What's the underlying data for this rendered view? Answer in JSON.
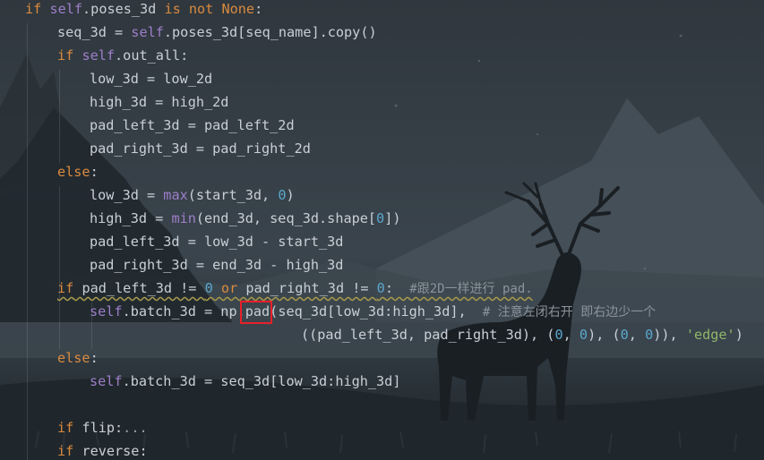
{
  "code": {
    "lines": [
      [
        {
          "t": "if",
          "c": "kw"
        },
        {
          "t": " ",
          "c": ""
        },
        {
          "t": "self",
          "c": "self"
        },
        {
          "t": ".poses_3d ",
          "c": ""
        },
        {
          "t": "is not None",
          "c": "kw"
        },
        {
          "t": ":",
          "c": ""
        }
      ],
      [
        {
          "t": "seq_3d = ",
          "c": ""
        },
        {
          "t": "self",
          "c": "self"
        },
        {
          "t": ".poses_3d[seq_name].copy()",
          "c": ""
        }
      ],
      [
        {
          "t": "if",
          "c": "kw"
        },
        {
          "t": " ",
          "c": ""
        },
        {
          "t": "self",
          "c": "self"
        },
        {
          "t": ".out_all:",
          "c": ""
        }
      ],
      [
        {
          "t": "low_3d = low_2d",
          "c": ""
        }
      ],
      [
        {
          "t": "high_3d = high_2d",
          "c": ""
        }
      ],
      [
        {
          "t": "pad_left_3d = pad_left_2d",
          "c": ""
        }
      ],
      [
        {
          "t": "pad_right_3d = pad_right_2d",
          "c": ""
        }
      ],
      [
        {
          "t": "else",
          "c": "kw"
        },
        {
          "t": ":",
          "c": ""
        }
      ],
      [
        {
          "t": "low_3d = ",
          "c": ""
        },
        {
          "t": "max",
          "c": "self"
        },
        {
          "t": "(start_3d, ",
          "c": ""
        },
        {
          "t": "0",
          "c": "num"
        },
        {
          "t": ")",
          "c": ""
        }
      ],
      [
        {
          "t": "high_3d = ",
          "c": ""
        },
        {
          "t": "min",
          "c": "self"
        },
        {
          "t": "(end_3d, seq_3d.shape[",
          "c": ""
        },
        {
          "t": "0",
          "c": "num"
        },
        {
          "t": "])",
          "c": ""
        }
      ],
      [
        {
          "t": "pad_left_3d = low_3d - start_3d",
          "c": ""
        }
      ],
      [
        {
          "t": "pad_right_3d = end_3d - high_3d",
          "c": ""
        }
      ],
      [
        {
          "t": "if",
          "c": "kw"
        },
        {
          "t": " pad_left_3d != ",
          "c": ""
        },
        {
          "t": "0",
          "c": "num"
        },
        {
          "t": " ",
          "c": ""
        },
        {
          "t": "or",
          "c": "kw"
        },
        {
          "t": " pad_right_3d != ",
          "c": ""
        },
        {
          "t": "0",
          "c": "num"
        },
        {
          "t": ":  ",
          "c": ""
        },
        {
          "t": "#跟2D一样进行 pad.",
          "c": "comment"
        }
      ],
      [
        {
          "t": "self",
          "c": "self"
        },
        {
          "t": ".batch_3d = np.",
          "c": ""
        },
        {
          "t": "pad",
          "c": ""
        },
        {
          "t": "(seq_3d[low_3d:high_3d],  ",
          "c": ""
        },
        {
          "t": "# 注意左闭右开 即右边少一个",
          "c": "comment"
        }
      ],
      [
        {
          "t": "((pad_left_3d, pad_right_3d), (",
          "c": ""
        },
        {
          "t": "0",
          "c": "num"
        },
        {
          "t": ", ",
          "c": ""
        },
        {
          "t": "0",
          "c": "num"
        },
        {
          "t": "), (",
          "c": ""
        },
        {
          "t": "0",
          "c": "num"
        },
        {
          "t": ", ",
          "c": ""
        },
        {
          "t": "0",
          "c": "num"
        },
        {
          "t": ")), ",
          "c": ""
        },
        {
          "t": "'edge'",
          "c": "str"
        },
        {
          "t": ")",
          "c": ""
        }
      ],
      [
        {
          "t": "else",
          "c": "kw"
        },
        {
          "t": ":",
          "c": ""
        }
      ],
      [
        {
          "t": "self",
          "c": "self"
        },
        {
          "t": ".batch_3d = seq_3d[low_3d:high_3d]",
          "c": ""
        }
      ],
      [],
      [
        {
          "t": "if",
          "c": "kw"
        },
        {
          "t": " flip:",
          "c": ""
        },
        {
          "t": "...",
          "c": "fold"
        }
      ],
      [
        {
          "t": "if",
          "c": "kw"
        },
        {
          "t": " reverse:",
          "c": ""
        }
      ]
    ]
  },
  "colors": {
    "keyword": "#d98a3f",
    "self": "#9d7fc9",
    "number": "#5aa7ce",
    "string": "#8fb56a",
    "comment": "#8b939b",
    "highlight_box": "#e8202a"
  }
}
